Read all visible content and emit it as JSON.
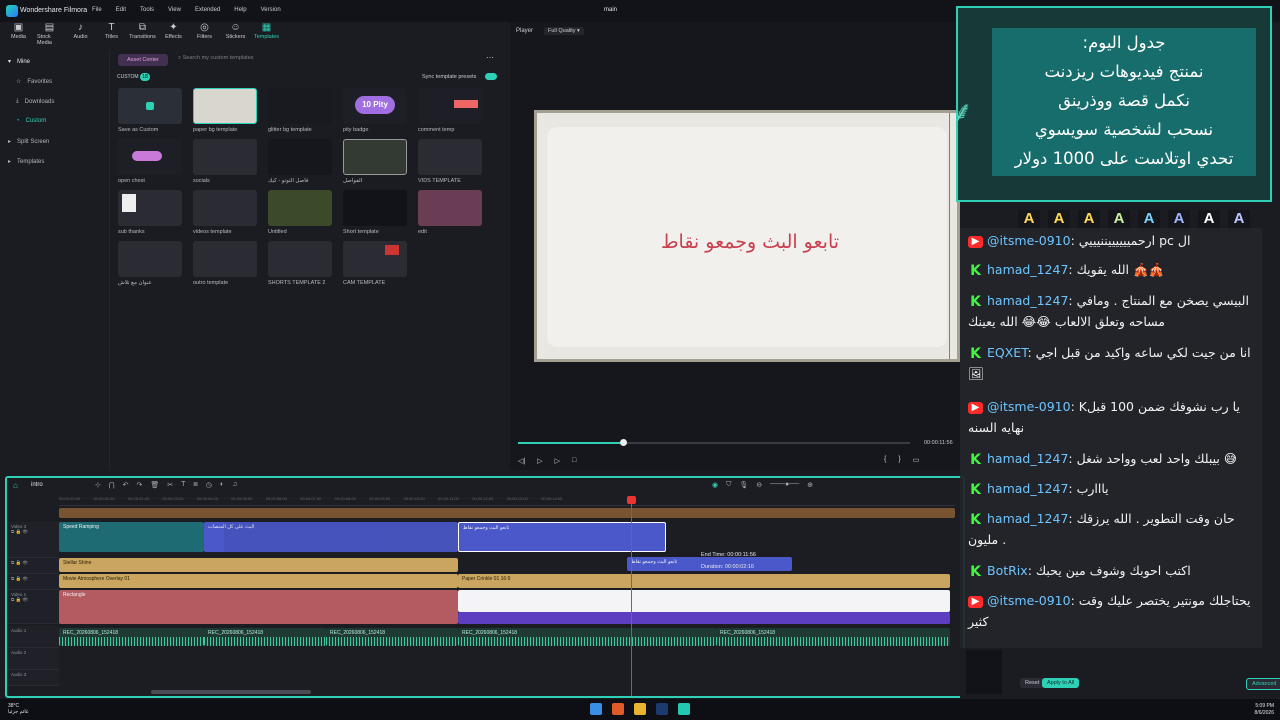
{
  "app": {
    "name": "Wondershare Filmora",
    "project": "main"
  },
  "menu": [
    "File",
    "Edit",
    "Tools",
    "View",
    "Extended",
    "Help",
    "Version"
  ],
  "toolbar": [
    {
      "label": "Media",
      "icon": "media-icon"
    },
    {
      "label": "Stock Media",
      "icon": "stock-media-icon"
    },
    {
      "label": "Audio",
      "icon": "audio-icon"
    },
    {
      "label": "Titles",
      "icon": "titles-icon"
    },
    {
      "label": "Transitions",
      "icon": "transitions-icon"
    },
    {
      "label": "Effects",
      "icon": "effects-icon"
    },
    {
      "label": "Filters",
      "icon": "filters-icon"
    },
    {
      "label": "Stickers",
      "icon": "stickers-icon"
    },
    {
      "label": "Templates",
      "icon": "templates-icon",
      "active": true
    }
  ],
  "sidebar": {
    "header": "Mine",
    "items": [
      "Favorites",
      "Downloads",
      "Custom",
      "Split Screen",
      "Templates"
    ]
  },
  "library": {
    "asset_center": "Asset Center",
    "search_placeholder": "Search my custom templates",
    "custom_label": "CUSTOM",
    "custom_count": "18",
    "sync_label": "Sync template presets",
    "items": [
      "Save as Custom",
      "paper bg template",
      "glitter bg template",
      "pity badge",
      "comment temp",
      "open chest",
      "socials",
      "فاصل التوتو - كيك",
      "الفواصل",
      "VIDS TEMPLATE",
      "sub thanks",
      "videos template",
      "Untitled",
      "Short template",
      "edit",
      "عنوان مع تلاش",
      "outro template",
      "SHORTS TEMPLATE 2",
      "CAM TEMPLATE"
    ],
    "pity_badge_text": "10 Pity"
  },
  "player": {
    "label": "Player",
    "quality": "Full Quality",
    "caption": "تابعو البث وجمعو نقاط",
    "timecode": "00:00:11:56"
  },
  "timeline": {
    "tab": "intro",
    "clips": {
      "v3a": "Speed Ramping",
      "v3b": "البث على كل المنصات",
      "v3c": "تابعو البث وجمعو نقاط",
      "v2a": "Stellar Shine",
      "v2b": "تابعو البث وجمعو نقاط",
      "v1a": "Movie Atmosphere Overlay 01",
      "v1b": "Paper Crinkle 01 16:9",
      "rect": "Rectangle",
      "audio": "REC_20260806_152418"
    },
    "tooltip": {
      "end_label": "End Time:",
      "end_value": "00:00:11:56",
      "dur_label": "Duration:",
      "dur_value": "00:00:02:16"
    },
    "track_labels": [
      "Video 3",
      "Video 2",
      "Video 1",
      "Audio 1",
      "Audio 2",
      "Audio 3"
    ]
  },
  "schedule": {
    "lines": [
      "جدول اليوم:",
      "نمنتج فيديوهات ريزدنت",
      "نكمل قصة ووذرينق",
      "نسحب لشخصية سويسوي",
      "تحدي اوتلاست على 1000 دولار"
    ]
  },
  "chat": [
    {
      "platform": "yt",
      "user": "@itsme-0910",
      "text": "ارحمييييييننيييي pc ال"
    },
    {
      "platform": "kick",
      "user": "hamad_1247",
      "text": "الله يقويك 🎪🎪"
    },
    {
      "platform": "kick",
      "user": "hamad_1247",
      "text": "البيسي يصخن مع المنتاج . ومافي مساحه وتعلق الالعاب 😂😂 الله يعينك"
    },
    {
      "platform": "kick",
      "user": "EQXET",
      "text": "انا من جيت لكي ساعه واكيد من قبل اجي 🖼"
    },
    {
      "platform": "yt",
      "user": "@itsme-0910",
      "text": "Kيا رب نشوفك ضمن 100 قبل نهايه السنه"
    },
    {
      "platform": "kick",
      "user": "hamad_1247",
      "text": "بيبلك واحد لعب وواحد شغل 😅"
    },
    {
      "platform": "kick",
      "user": "hamad_1247",
      "text": "يااارب"
    },
    {
      "platform": "kick",
      "user": "hamad_1247",
      "text": "حان وقت التطوير . الله يرزقك مليون ."
    },
    {
      "platform": "kick",
      "user": "BotRix",
      "text": "اكتب احوبك وشوف مين يحبك"
    },
    {
      "platform": "yt",
      "user": "@itsme-0910",
      "text": "يحتاجلك مونتير يختصر عليك وقت كثير"
    }
  ],
  "rpanel": {
    "reset": "Reset",
    "apply_all": "Apply to All",
    "advanced": "Advanced"
  },
  "taskbar": {
    "temp": "38°C",
    "weather": "غائم جزئيا",
    "time": "5:09 PM",
    "date": "8/6/2026"
  },
  "colors": {
    "accent": "#2fd1b6",
    "clip_blue": "#4a58c9",
    "clip_gold": "#c9a560",
    "clip_rose": "#b45b61"
  }
}
